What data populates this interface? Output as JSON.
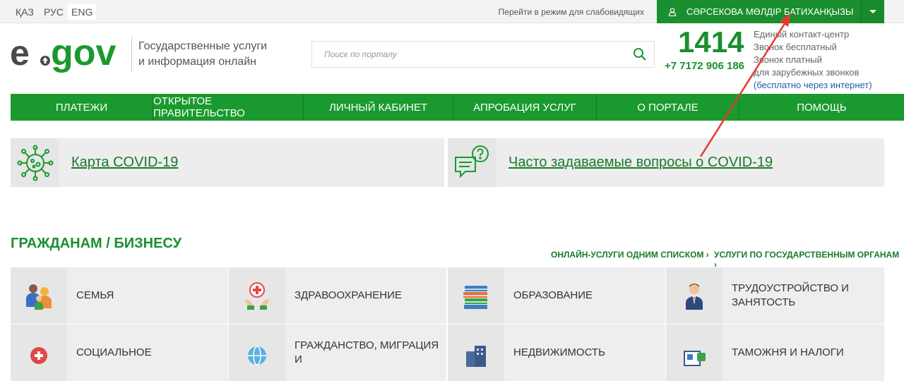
{
  "topbar": {
    "languages": [
      {
        "label": "ҚАЗ",
        "active": false
      },
      {
        "label": "РУС",
        "active": false
      },
      {
        "label": "ENG",
        "active": true
      }
    ],
    "low_vision": "Перейти в режим для слабовидящих",
    "user_name": "СӘРСЕКОВА МӨЛДІР БАТИХАНҚЫЗЫ"
  },
  "header": {
    "logo_left": "e",
    "logo_right": "gov",
    "tagline_line1": "Государственные услуги",
    "tagline_line2": "и информация онлайн",
    "search_placeholder": "Поиск по порталу",
    "hotline": "1414",
    "phone": "+7 7172 906 186",
    "contact_lines": [
      "Единый контакт-центр",
      "Звонок бесплатный",
      "Звонок платный",
      "для зарубежных звонков"
    ],
    "contact_link": "(бесплатно через интернет)"
  },
  "nav": [
    "ПЛАТЕЖИ",
    "ОТКРЫТОЕ ПРАВИТЕЛЬСТВО",
    "ЛИЧНЫЙ КАБИНЕТ",
    "АПРОБАЦИЯ УСЛУГ",
    "О ПОРТАЛЕ",
    "ПОМОЩЬ"
  ],
  "banners": [
    {
      "label": "Карта COVID-19",
      "icon": "virus-icon"
    },
    {
      "label": "Часто задаваемые вопросы о COVID-19",
      "icon": "faq-chat-icon"
    }
  ],
  "section": {
    "title_a": "ГРАЖДАНАМ",
    "slash": " / ",
    "title_b": "БИЗНЕСУ",
    "link_all": "ОНЛАЙН-УСЛУГИ ОДНИМ СПИСКОМ",
    "link_agencies": "УСЛУГИ ПО ГОСУДАРСТВЕННЫМ ОРГАНАМ",
    "tiles": [
      {
        "label": "СЕМЬЯ",
        "icon": "family-icon"
      },
      {
        "label": "ЗДРАВООХРАНЕНИЕ",
        "icon": "healthcare-icon"
      },
      {
        "label": "ОБРАЗОВАНИЕ",
        "icon": "books-icon"
      },
      {
        "label": "ТРУДОУСТРОЙСТВО И ЗАНЯТОСТЬ",
        "icon": "worker-icon"
      },
      {
        "label": "СОЦИАЛЬНОЕ",
        "icon": "social-icon"
      },
      {
        "label": "ГРАЖДАНСТВО, МИГРАЦИЯ И",
        "icon": "globe-icon"
      },
      {
        "label": "НЕДВИЖИМОСТЬ",
        "icon": "buildings-icon"
      },
      {
        "label": "ТАМОЖНЯ И НАЛОГИ",
        "icon": "customs-icon"
      }
    ]
  },
  "colors": {
    "brand_green": "#1a9a2e",
    "annotation_arrow": "#e23b2e"
  }
}
